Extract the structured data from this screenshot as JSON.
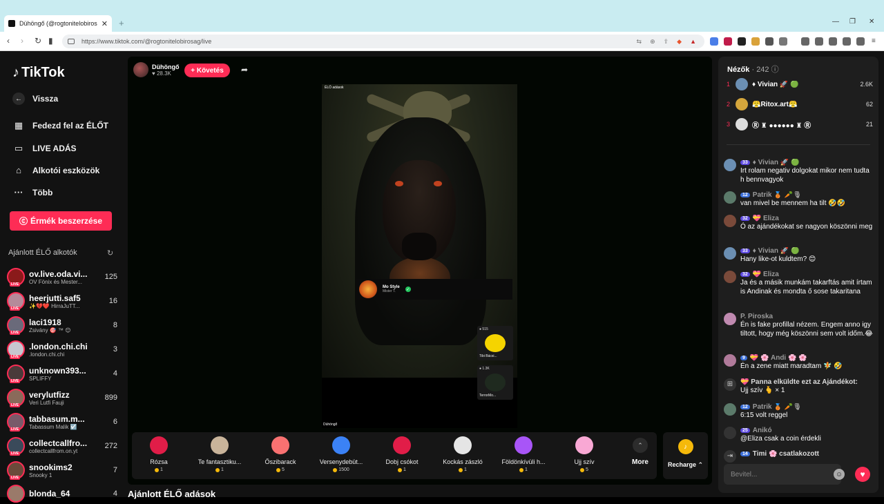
{
  "browser": {
    "tab_title": "Dühöngő (@rogtonitelobiros",
    "tab_close": "✕",
    "new_tab": "+",
    "url": "https://www.tiktok.com/@rogtonitelobirosag/live",
    "window_controls": [
      "—",
      "❐",
      "✕"
    ]
  },
  "sidebar": {
    "logo": "TikTok",
    "nav": [
      {
        "label": "Vissza",
        "icon": "back-arrow"
      },
      {
        "label": "Fedezd fel az ÉLŐT",
        "icon": "calendar"
      },
      {
        "label": "LIVE ADÁS",
        "icon": "camera"
      },
      {
        "label": "Alkotói eszközök",
        "icon": "home"
      },
      {
        "label": "Több",
        "icon": "ellipsis"
      }
    ],
    "coins_button": "Érmék beszerzése",
    "recommended_title": "Ajánlott ÉLŐ alkotók",
    "creators": [
      {
        "name": "ov.live.oda.vi...",
        "sub": "OV Fönix és Mester...",
        "count": "125"
      },
      {
        "name": "heerjutti.saf5",
        "sub": "✨💔❤️ HirraJuTT...",
        "count": "16"
      },
      {
        "name": "laci1918",
        "sub": "Zsivány 🎯 ™ 😊",
        "count": "8"
      },
      {
        "name": ".london.chi.chi",
        "sub": ".london.chi.chi",
        "count": "3"
      },
      {
        "name": "unknown393...",
        "sub": "SPLIFFY",
        "count": "4"
      },
      {
        "name": "verylutfizz",
        "sub": "Veri Lutfi Fauji",
        "count": "899"
      },
      {
        "name": "tabbasum.m...",
        "sub": "Tabassum Malik ☑️",
        "count": "6"
      },
      {
        "name": "collectcallfro...",
        "sub": "collectcallfrom.on.yt",
        "count": "272"
      },
      {
        "name": "snookims2",
        "sub": "Snooky 1",
        "count": "7"
      },
      {
        "name": "blonda_64",
        "sub": "",
        "count": "4"
      }
    ]
  },
  "stream": {
    "host_name": "Dühöngő",
    "host_likes": "28.3K",
    "follow_label": "+ Követés",
    "video_top_tag": "ÉLŐ adások",
    "video_bottom_tag": "Dühöngő",
    "overlay_name": "Mo Style",
    "overlay_sub": "Mister T.",
    "mini_cards": [
      {
        "top": "515",
        "bottom": "Tibi Bácsi..."
      },
      {
        "top": "1.3K",
        "bottom": "TerrorMo..."
      }
    ]
  },
  "gifts": [
    {
      "name": "Rózsa",
      "price": "1",
      "color": "#e11d48"
    },
    {
      "name": "Te fantasztiku...",
      "price": "1",
      "color": "#c9b49a"
    },
    {
      "name": "Őszibarack",
      "price": "5",
      "color": "#f87171"
    },
    {
      "name": "Versenydebüt...",
      "price": "1500",
      "color": "#3b82f6"
    },
    {
      "name": "Dobj csókot",
      "price": "1",
      "color": "#e11d48"
    },
    {
      "name": "Kockás zászló",
      "price": "1",
      "color": "#e5e5e5"
    },
    {
      "name": "Földönkívüli h...",
      "price": "1",
      "color": "#a855f7"
    },
    {
      "name": "Ujj szív",
      "price": "5",
      "color": "#f9a8d4"
    }
  ],
  "more_label": "More",
  "recharge_label": "Recharge",
  "section_title": "Ajánlott ÉLŐ adások",
  "chat": {
    "viewers_label": "Nézők",
    "viewers_count": "· 242",
    "top_viewers": [
      {
        "rank": "1",
        "name": "♦ Vivian 🚀 🟢",
        "score": "2.6K",
        "color": "#6b8fb3"
      },
      {
        "rank": "2",
        "name": "😤Ritox.art😤",
        "score": "62",
        "color": "#d4a63c"
      },
      {
        "rank": "3",
        "name": "Ⓡ ♜ ●●●●●● ♜ Ⓡ",
        "score": "21",
        "color": "#ddd"
      }
    ],
    "messages": [
      {
        "badge": "33",
        "user": "♦ Vivian 🚀 🟢",
        "text": "Irt rolam negativ dolgokat mikor nem tudta h bennvagyok",
        "color": "#6b8fb3"
      },
      {
        "badge": "12",
        "user": "Patrik 🥉 🥕🎙",
        "text": "van mivel be mennem ha tilt 🤣🤣",
        "color": "#5b7a6a"
      },
      {
        "badge": "32",
        "user": "💝 Eliza",
        "text": "Ó az ajándékokat se nagyon köszönni meg",
        "color": "#7a4a3a"
      },
      {
        "badge": "33",
        "user": "♦ Vivian 🚀 🟢",
        "text": "Hany like-ot kuldtem? 😊",
        "color": "#6b8fb3"
      },
      {
        "badge": "32",
        "user": "💝 Eliza",
        "text": "Ja és a másik munkám takarftás amit írtam is Andinak és mondta ő sose takaritana",
        "color": "#7a4a3a"
      },
      {
        "badge": "",
        "user": "P. Piroska",
        "text": "Én is fake profillal nézem. Engem anno igy tiltott, hogy még köszönni sem volt időm.😂",
        "color": "#c08ab0"
      },
      {
        "badge": "9",
        "user": "💝 🌸 Andi 🌸 🌸",
        "text": "Én a zene miatt maradtam 🧚 🤣",
        "color": "#b07a9a"
      },
      {
        "badge": "",
        "user": "💝 Panna elküldte ezt az Ajándékot:",
        "text": "Ujj szív 🫰 × 1",
        "color": "#444"
      },
      {
        "badge": "12",
        "user": "Patrik 🥉 🥕🎙",
        "text": "6:15 volt reggel",
        "color": "#5b7a6a"
      },
      {
        "badge": "25",
        "user": "Anikó",
        "text": "@Eliza csak a coin érdekli",
        "color": "#333"
      },
      {
        "badge": "14",
        "user": "Timi 🌸 csatlakozott",
        "text": "",
        "color": "#444"
      }
    ],
    "input_placeholder": "Bevitel..."
  }
}
